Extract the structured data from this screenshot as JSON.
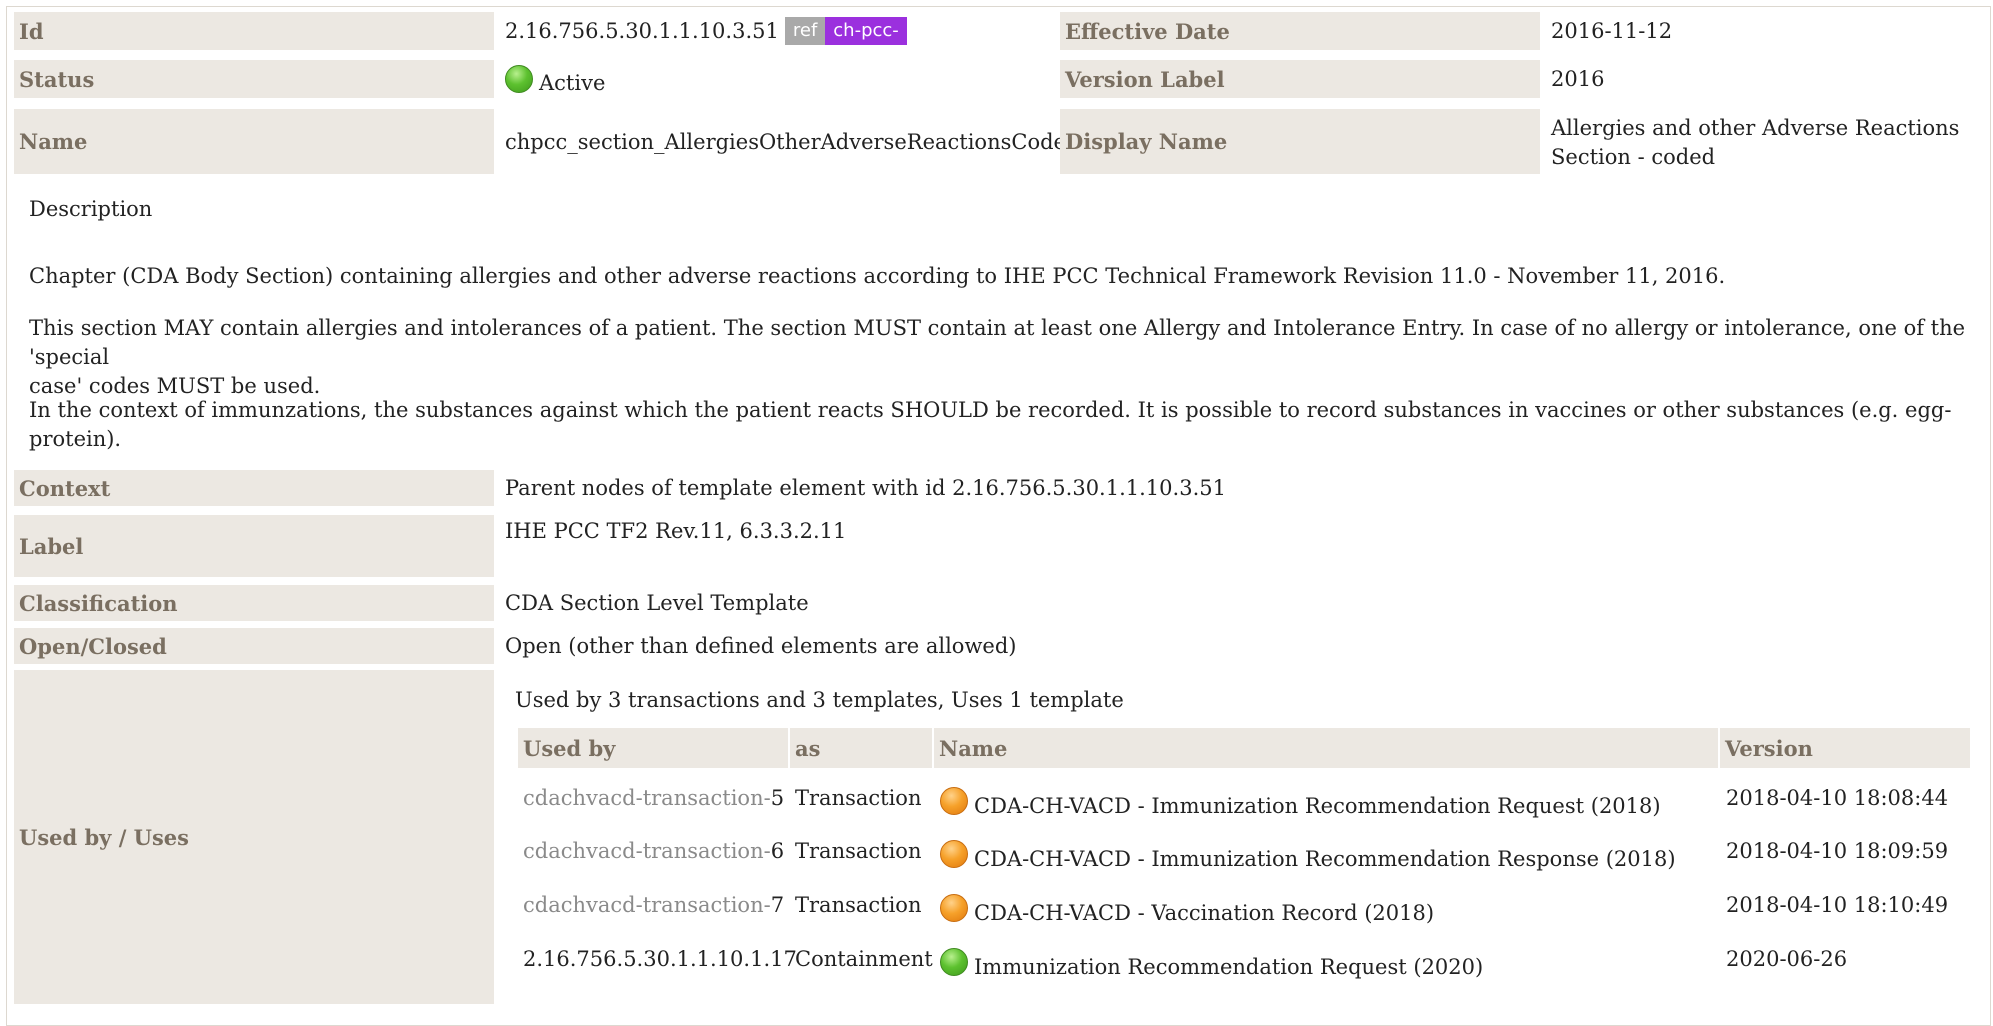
{
  "header": {
    "id_label": "Id",
    "id_value": "2.16.756.5.30.1.1.10.3.51",
    "badge_ref": "ref",
    "badge_prefix": "ch-pcc-",
    "effective_date_label": "Effective Date",
    "effective_date_value": "2016-11-12",
    "status_label": "Status",
    "status_value": "Active",
    "status_color": "#5dc12f",
    "version_label_label": "Version Label",
    "version_label_value": "2016",
    "name_label": "Name",
    "name_value": "chpcc_section_AllergiesOtherAdverseReactionsCoded",
    "display_name_label": "Display Name",
    "display_name_line1": "Allergies and other Adverse Reactions",
    "display_name_line2": "Section - coded"
  },
  "description": {
    "heading": "Description",
    "p1": "Chapter (CDA Body Section) containing allergies and other adverse reactions according to IHE PCC Technical Framework Revision 11.0 - November 11, 2016.",
    "p2_line1": "This section MAY contain allergies and intolerances of a patient. The section MUST contain at least one Allergy and Intolerance Entry. In case of no allergy or intolerance, one of the 'special",
    "p2_line2": "case' codes MUST be used.",
    "p3": "In the context of immunzations, the substances against which the patient reacts SHOULD be recorded. It is possible to record substances in vaccines or other substances (e.g. egg-protein)."
  },
  "details": {
    "context_label": "Context",
    "context_value": "Parent nodes of template element with id 2.16.756.5.30.1.1.10.3.51",
    "label_label": "Label",
    "label_value": "IHE PCC TF2 Rev.11, 6.3.3.2.11",
    "classification_label": "Classification",
    "classification_value": "CDA Section Level Template",
    "open_closed_label": "Open/Closed",
    "open_closed_value": "Open (other than defined elements are allowed)",
    "used_by_label": "Used by / Uses"
  },
  "usage": {
    "summary": "Used by 3 transactions and 3 templates, Uses 1 template",
    "columns": [
      "Used by",
      "as",
      "Name",
      "Version"
    ],
    "rows": [
      {
        "used_by_prefix": "cdachvacd-transaction-",
        "used_by_num": "5",
        "as": "Transaction",
        "status_icon": "orange",
        "name": "CDA-CH-VACD - Immunization Recommendation Request (2018)",
        "version": "2018-04-10 18:08:44"
      },
      {
        "used_by_prefix": "cdachvacd-transaction-",
        "used_by_num": "6",
        "as": "Transaction",
        "status_icon": "orange",
        "name": "CDA-CH-VACD - Immunization Recommendation Response (2018)",
        "version": "2018-04-10 18:09:59"
      },
      {
        "used_by_prefix": "cdachvacd-transaction-",
        "used_by_num": "7",
        "as": "Transaction",
        "status_icon": "orange",
        "name": "CDA-CH-VACD - Vaccination Record (2018)",
        "version": "2018-04-10 18:10:49"
      },
      {
        "used_by_prefix": "",
        "used_by_num": "2.16.756.5.30.1.1.10.1.17",
        "as": "Containment",
        "status_icon": "green",
        "name": "Immunization Recommendation Request (2020)",
        "version": "2020-06-26"
      }
    ]
  }
}
